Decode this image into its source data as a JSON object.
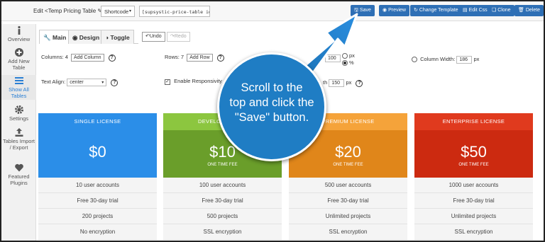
{
  "topbar": {
    "edit_prefix": "Edit",
    "table_name": "<Temp Pricing Table",
    "shortcode_label": "Shortcode",
    "shortcode_value": "[supsystic-price-table id=8]",
    "buttons": {
      "save": "Save",
      "preview": "Preview",
      "change_template": "Change Template",
      "edit_css": "Edit Css",
      "clone": "Clone",
      "delete": "Delete"
    }
  },
  "sidebar": {
    "items": [
      {
        "label": "Overview",
        "icon": "info-icon"
      },
      {
        "label": "Add New Table",
        "icon": "plus-circle-icon"
      },
      {
        "label": "Show All Tables",
        "icon": "list-icon"
      },
      {
        "label": "Settings",
        "icon": "gear-icon"
      },
      {
        "label": "Tables Import / Export",
        "icon": "upload-icon"
      },
      {
        "label": "Featured Plugins",
        "icon": "heart-icon"
      }
    ]
  },
  "tabs": {
    "main": "Main",
    "design": "Design",
    "toggle": "Toggle",
    "undo": "Undo",
    "redo": "Redo"
  },
  "settings": {
    "columns_label": "Columns: 4",
    "add_column": "Add Column",
    "rows_label": "Rows: 7",
    "add_row": "Add Row",
    "width_value": "100",
    "unit_px": "px",
    "unit_pct": "%",
    "column_width_label": "Column Width:",
    "column_width_value": "186",
    "column_width_unit": "px",
    "text_align_label": "Text Align:",
    "text_align_value": "center",
    "responsivity_label": "Enable Responsivity",
    "partial_label": "th",
    "partial_value": "150",
    "partial_unit": "px",
    "help": "?"
  },
  "plans": [
    {
      "name": "SINGLE LICENSE",
      "price": "$0",
      "fee": "",
      "color_head": "#2b8ee8",
      "color_price": "#2b8ee8",
      "features": [
        "10 user accounts",
        "Free 30-day trial",
        "200 projects",
        "No encryption"
      ]
    },
    {
      "name": "DEVELO",
      "price": "$10",
      "fee": "ONE TIME FEE",
      "color_head": "#8cc63f",
      "color_price": "#6a9e2a",
      "features": [
        "100 user accounts",
        "Free 30-day trial",
        "500 projects",
        "SSL encryption"
      ]
    },
    {
      "name": "PREMIUM LICENSE",
      "price": "$20",
      "fee": "ONE TIME FEE",
      "color_head": "#f5a33a",
      "color_price": "#e0861a",
      "features": [
        "500 user accounts",
        "Free 30-day trial",
        "Unlimited projects",
        "SSL encryption"
      ]
    },
    {
      "name": "ENTERPRISE LICENSE",
      "price": "$50",
      "fee": "ONE TIME FEE",
      "color_head": "#e03a1e",
      "color_price": "#cc2a10",
      "features": [
        "1000 user accounts",
        "Free 30-day trial",
        "Unlimited projects",
        "SSL encryption"
      ]
    }
  ],
  "callout": {
    "line1": "Scroll to the",
    "line2": "top and click the",
    "line3": "\"Save\" button.",
    "color": "#1f7dc4"
  }
}
